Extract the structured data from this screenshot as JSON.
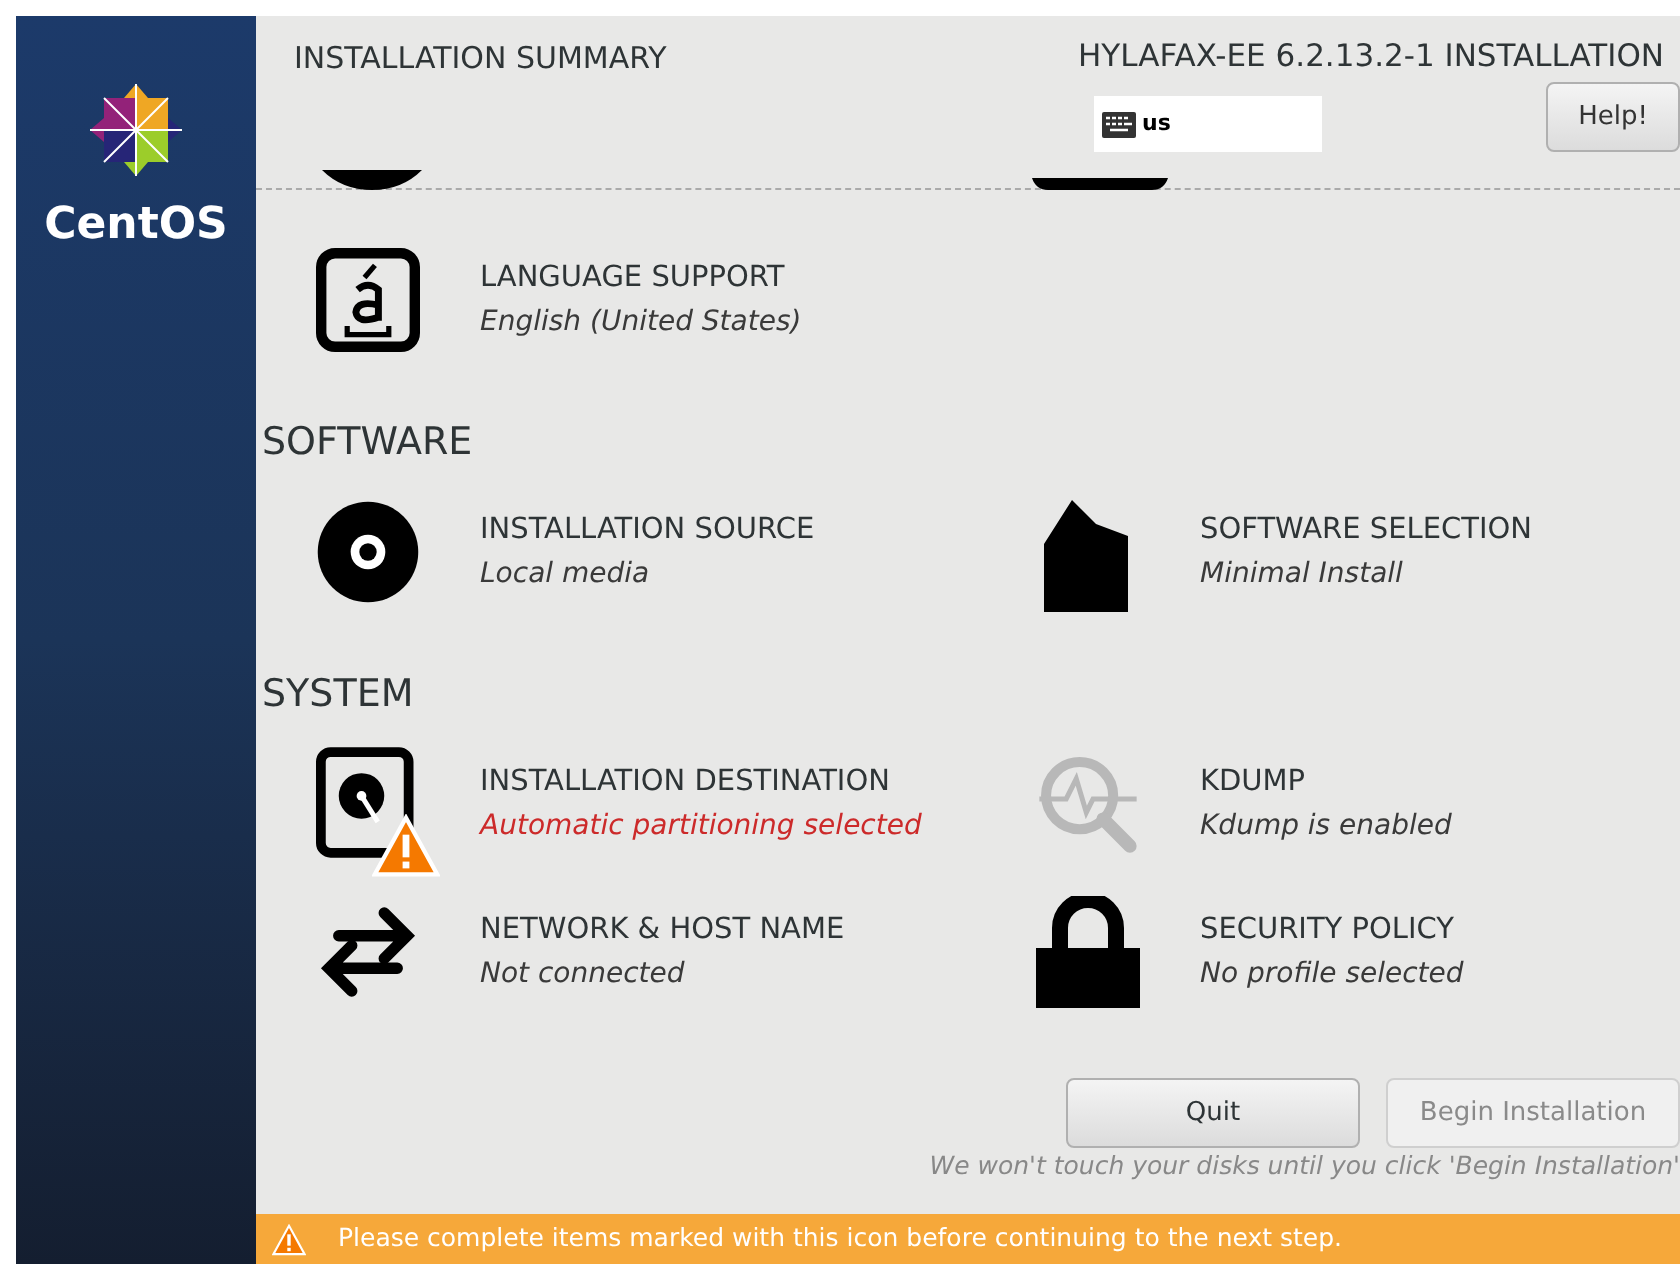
{
  "sidebar": {
    "logo_text": "CentOS"
  },
  "header": {
    "title": "INSTALLATION SUMMARY",
    "product": "HYLAFAX-EE 6.2.13.2-1 INSTALLATION",
    "keyboard": "us",
    "help_button": "Help!"
  },
  "localization_items": [
    {
      "kind": "language",
      "title": "LANGUAGE SUPPORT",
      "status": "English (United States)",
      "warning": false
    }
  ],
  "sections": [
    {
      "heading": "SOFTWARE",
      "items": [
        {
          "kind": "disc",
          "title": "INSTALLATION SOURCE",
          "status": "Local media",
          "warning": false
        },
        {
          "kind": "package",
          "title": "SOFTWARE SELECTION",
          "status": "Minimal Install",
          "warning": false
        }
      ]
    },
    {
      "heading": "SYSTEM",
      "items": [
        {
          "kind": "disk",
          "title": "INSTALLATION DESTINATION",
          "status": "Automatic partitioning selected",
          "warning": true
        },
        {
          "kind": "search",
          "title": "KDUMP",
          "status": "Kdump is enabled",
          "warning": false
        },
        {
          "kind": "network",
          "title": "NETWORK & HOST NAME",
          "status": "Not connected",
          "warning": false
        },
        {
          "kind": "lock",
          "title": "SECURITY POLICY",
          "status": "No profile selected",
          "warning": false
        }
      ]
    }
  ],
  "buttons": [
    {
      "label": "Quit",
      "disabled": false
    },
    {
      "label": "Begin Installation",
      "disabled": true
    }
  ],
  "note": "We won't touch your disks until you click 'Begin Installation'",
  "warning_bar": "Please complete items marked with this icon before continuing to the next step."
}
